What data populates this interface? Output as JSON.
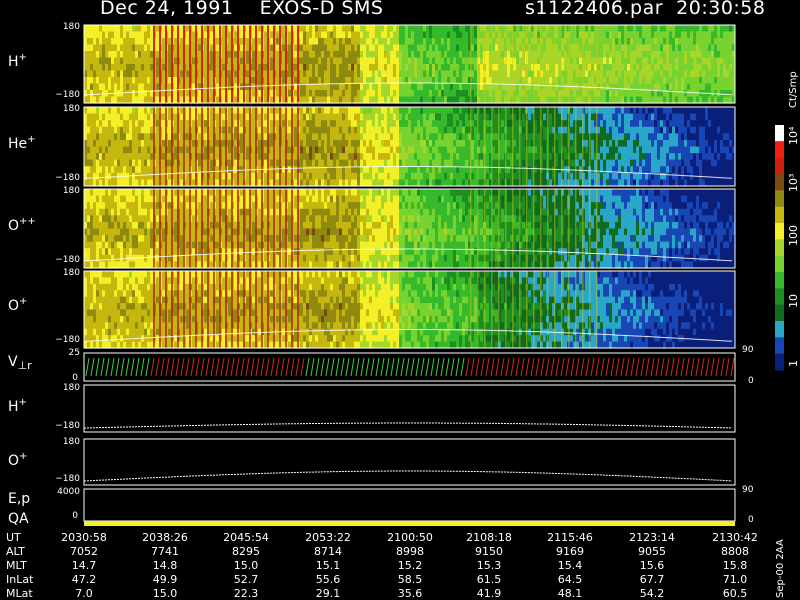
{
  "header": {
    "title": "Dec 24, 1991    EXOS-D SMS",
    "file": "s1122406.par  20:30:58"
  },
  "colorbar": {
    "unit_label": "Ct/Smp",
    "tick_labels": [
      "10⁴",
      "10³",
      "100",
      "10",
      "1"
    ]
  },
  "panels": [
    {
      "label": "H",
      "sup": "+",
      "top": "180",
      "bottom": "−180"
    },
    {
      "label": "He",
      "sup": "+",
      "top": "180",
      "bottom": "−180"
    },
    {
      "label": "O",
      "sup": "++",
      "top": "180",
      "bottom": "−180"
    },
    {
      "label": "O",
      "sup": "+",
      "top": "180",
      "bottom": "−180"
    }
  ],
  "velocity_panel": {
    "label": "V",
    "sub": "⊥r",
    "top": "25",
    "bottom": "0",
    "right_top": "90",
    "right_bottom": "0"
  },
  "line_panels": [
    {
      "label": "H",
      "sup": "+",
      "top": "180",
      "bottom": "−180"
    },
    {
      "label": "O",
      "sup": "+",
      "top": "180",
      "bottom": "−180"
    }
  ],
  "ep_panel": {
    "label": "E,p",
    "top": "4000",
    "bottom": "0",
    "right_top": "90",
    "right_bottom": "0"
  },
  "qa_panel": {
    "label": "QA"
  },
  "side_label": "Sep-00  2AA",
  "chart_data": {
    "type": "heatmap",
    "title": "Dec 24, 1991    EXOS-D SMS",
    "panels": [
      "H+",
      "He+",
      "O++",
      "O+"
    ],
    "colorbar_unit": "Ct/Smp",
    "colorbar_ticks": [
      "10⁴",
      "10³",
      "100",
      "10",
      "1"
    ],
    "y_range": [
      -180,
      180
    ],
    "x_ticks": [
      "2030:58",
      "2038:26",
      "2045:54",
      "2053:22",
      "2100:50",
      "2108:18",
      "2115:46",
      "2123:14",
      "2130:42"
    ]
  },
  "table": {
    "rows": [
      {
        "label": "UT",
        "values": [
          "2030:58",
          "2038:26",
          "2045:54",
          "2053:22",
          "2100:50",
          "2108:18",
          "2115:46",
          "2123:14",
          "2130:42"
        ]
      },
      {
        "label": "ALT",
        "values": [
          "7052",
          "7741",
          "8295",
          "8714",
          "8998",
          "9150",
          "9169",
          "9055",
          "8808"
        ]
      },
      {
        "label": "MLT",
        "values": [
          "14.7",
          "14.8",
          "15.0",
          "15.1",
          "15.2",
          "15.3",
          "15.4",
          "15.6",
          "15.8"
        ]
      },
      {
        "label": "InLat",
        "values": [
          "47.2",
          "49.9",
          "52.7",
          "55.6",
          "58.5",
          "61.5",
          "64.5",
          "67.7",
          "71.0"
        ]
      },
      {
        "label": "MLat",
        "values": [
          "7.0",
          "15.0",
          "22.3",
          "29.1",
          "35.6",
          "41.9",
          "48.1",
          "54.2",
          "60.5"
        ]
      }
    ]
  }
}
